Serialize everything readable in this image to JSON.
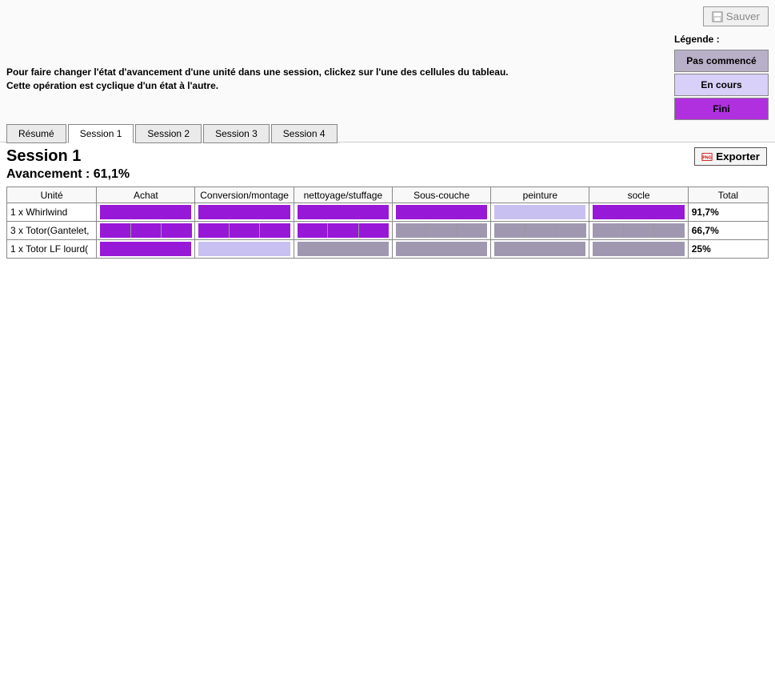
{
  "buttons": {
    "save": "Sauver",
    "export": "Exporter"
  },
  "instructions": {
    "line1": "Pour faire changer l'état d'avancement d'une unité dans une session, clickez sur l'une des cellules du tableau.",
    "line2": "Cette opération est cyclique d'un état à l'autre."
  },
  "legend": {
    "title": "Légende :",
    "not_started": "Pas commencé",
    "in_progress": "En cours",
    "done": "Fini"
  },
  "tabs": [
    "Résumé",
    "Session 1",
    "Session 2",
    "Session 3",
    "Session 4"
  ],
  "active_tab": 1,
  "session": {
    "title": "Session 1",
    "progress_label": "Avancement : 61,1%"
  },
  "columns": [
    "Unité",
    "Achat",
    "Conversion/montage",
    "nettoyage/stuffage",
    "Sous-couche",
    "peinture",
    "socle",
    "Total"
  ],
  "rows": [
    {
      "unit": "1 x Whirlwind",
      "cells": [
        [
          "done"
        ],
        [
          "done"
        ],
        [
          "done"
        ],
        [
          "done"
        ],
        [
          "prog"
        ],
        [
          "done"
        ]
      ],
      "total": "91,7%"
    },
    {
      "unit": "3 x Totor(Gantelet,",
      "cells": [
        [
          "done",
          "done",
          "done"
        ],
        [
          "done",
          "done",
          "done"
        ],
        [
          "done",
          "done",
          "done"
        ],
        [
          "not",
          "not",
          "not"
        ],
        [
          "not",
          "not",
          "not"
        ],
        [
          "not",
          "not",
          "not"
        ]
      ],
      "total": "66,7%"
    },
    {
      "unit": "1 x Totor LF lourd(",
      "cells": [
        [
          "done"
        ],
        [
          "prog"
        ],
        [
          "not"
        ],
        [
          "not"
        ],
        [
          "not"
        ],
        [
          "not"
        ]
      ],
      "total": "25%"
    }
  ]
}
